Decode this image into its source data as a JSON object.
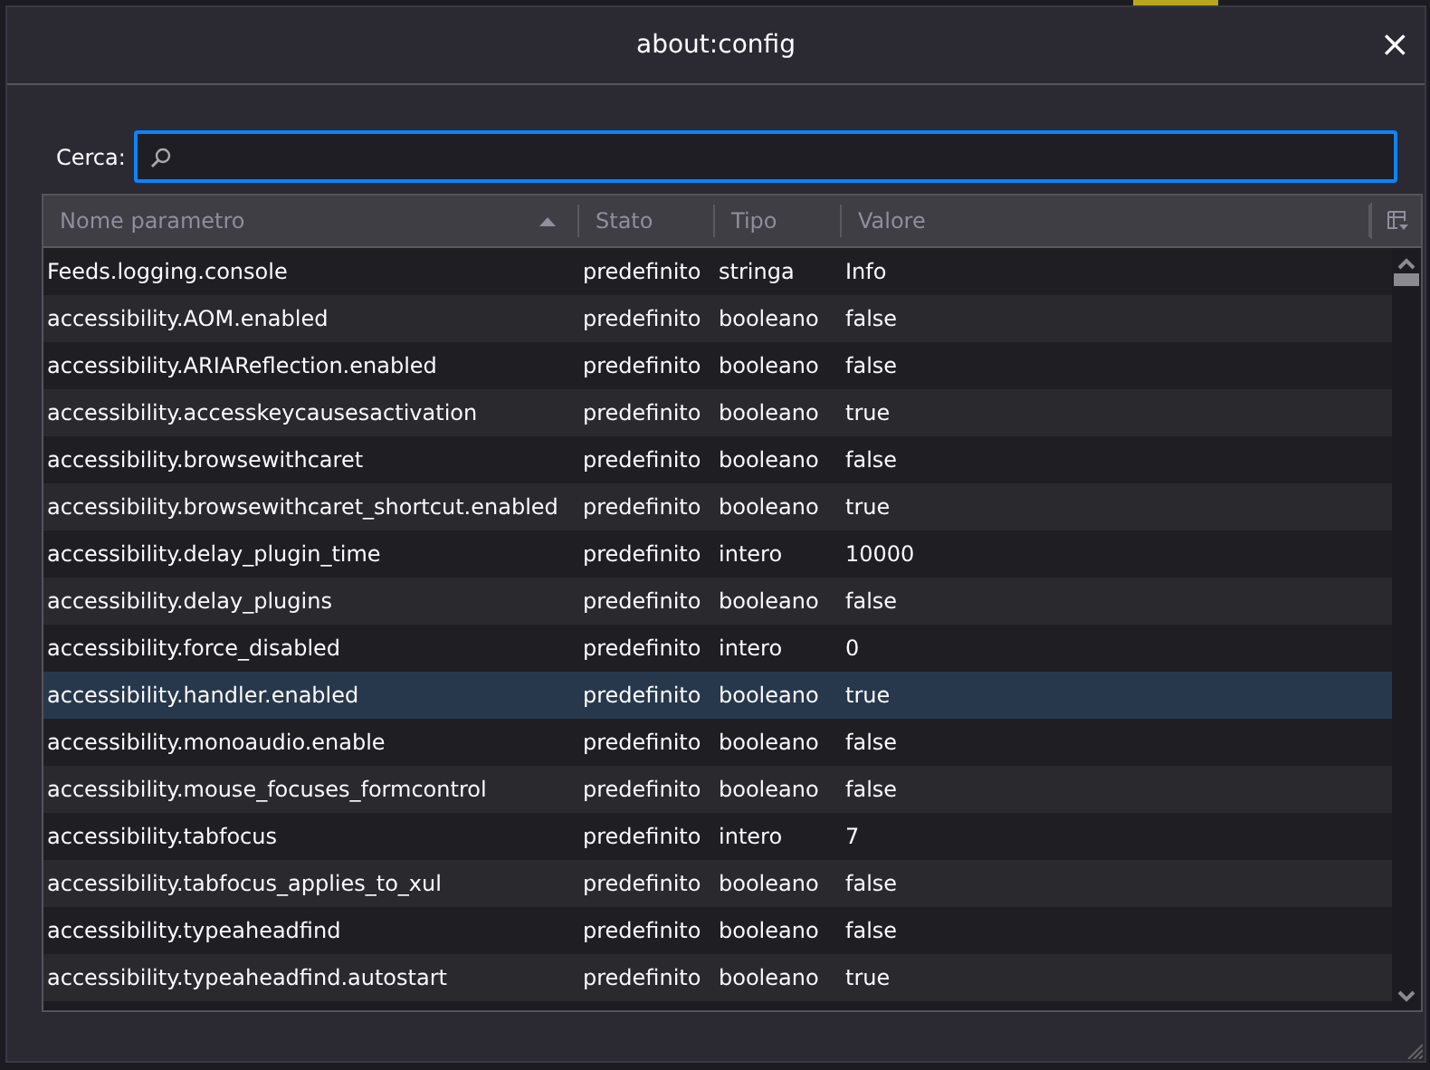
{
  "window": {
    "title": "about:config",
    "close": "×"
  },
  "search": {
    "label": "Cerca:"
  },
  "table": {
    "columns": [
      {
        "label": "Nome parametro",
        "sorted": true
      },
      {
        "label": "Stato",
        "sorted": false
      },
      {
        "label": "Tipo",
        "sorted": false
      },
      {
        "label": "Valore",
        "sorted": false
      }
    ],
    "rows": [
      {
        "cells": [
          "Feeds.logging.console",
          "predefinito",
          "stringa",
          "Info"
        ],
        "selected": false
      },
      {
        "cells": [
          "accessibility.AOM.enabled",
          "predefinito",
          "booleano",
          "false"
        ],
        "selected": false
      },
      {
        "cells": [
          "accessibility.ARIAReflection.enabled",
          "predefinito",
          "booleano",
          "false"
        ],
        "selected": false
      },
      {
        "cells": [
          "accessibility.accesskeycausesactivation",
          "predefinito",
          "booleano",
          "true"
        ],
        "selected": false
      },
      {
        "cells": [
          "accessibility.browsewithcaret",
          "predefinito",
          "booleano",
          "false"
        ],
        "selected": false
      },
      {
        "cells": [
          "accessibility.browsewithcaret_shortcut.enabled",
          "predefinito",
          "booleano",
          "true"
        ],
        "selected": false
      },
      {
        "cells": [
          "accessibility.delay_plugin_time",
          "predefinito",
          "intero",
          "10000"
        ],
        "selected": false
      },
      {
        "cells": [
          "accessibility.delay_plugins",
          "predefinito",
          "booleano",
          "false"
        ],
        "selected": false
      },
      {
        "cells": [
          "accessibility.force_disabled",
          "predefinito",
          "intero",
          "0"
        ],
        "selected": false
      },
      {
        "cells": [
          "accessibility.handler.enabled",
          "predefinito",
          "booleano",
          "true"
        ],
        "selected": true
      },
      {
        "cells": [
          "accessibility.monoaudio.enable",
          "predefinito",
          "booleano",
          "false"
        ],
        "selected": false
      },
      {
        "cells": [
          "accessibility.mouse_focuses_formcontrol",
          "predefinito",
          "booleano",
          "false"
        ],
        "selected": false
      },
      {
        "cells": [
          "accessibility.tabfocus",
          "predefinito",
          "intero",
          "7"
        ],
        "selected": false
      },
      {
        "cells": [
          "accessibility.tabfocus_applies_to_xul",
          "predefinito",
          "booleano",
          "false"
        ],
        "selected": false
      },
      {
        "cells": [
          "accessibility.typeaheadfind",
          "predefinito",
          "booleano",
          "false"
        ],
        "selected": false
      },
      {
        "cells": [
          "accessibility.typeaheadfind.autostart",
          "predefinito",
          "booleano",
          "true"
        ],
        "selected": false
      }
    ]
  }
}
